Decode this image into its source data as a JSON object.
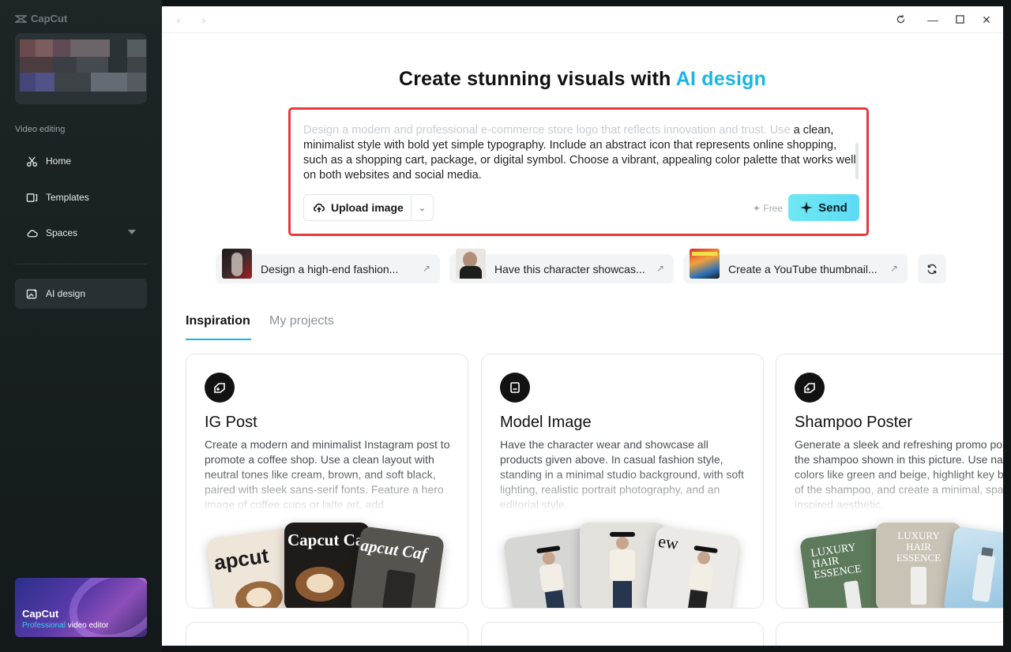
{
  "sidebar": {
    "logo_text": "CapCut",
    "section_label": "Video editing",
    "items": [
      {
        "label": "Home",
        "icon": "scissors-icon"
      },
      {
        "label": "Templates",
        "icon": "template-icon"
      },
      {
        "label": "Spaces",
        "icon": "cloud-icon"
      },
      {
        "label": "AI design",
        "icon": "ai-image-icon"
      }
    ],
    "promo": {
      "title": "CapCut",
      "sub_highlight": "Professional",
      "sub_rest": " video editor"
    }
  },
  "main": {
    "headline_prefix": "Create stunning visuals with ",
    "headline_accent": "AI design",
    "prompt": {
      "faded_line": "Design a modern and professional e-commerce store logo that reflects innovation and trust. Use",
      "text": "a clean, minimalist style with bold yet simple typography. Include an abstract icon that represents online shopping, such as a shopping cart, package, or digital symbol. Choose a vibrant, appealing color palette that works well on both websites and social media.",
      "upload_label": "Upload image",
      "free_label": "✦ Free",
      "send_label": "Send"
    },
    "suggestions": [
      {
        "label": "Design a high-end fashion..."
      },
      {
        "label": "Have this character showcas..."
      },
      {
        "label": "Create a YouTube thumbnail..."
      }
    ],
    "tabs": [
      {
        "label": "Inspiration",
        "active": true
      },
      {
        "label": "My projects",
        "active": false
      }
    ],
    "cards": [
      {
        "title": "IG Post",
        "desc": "Create a modern and minimalist Instagram post to promote a coffee shop. Use a clean layout with neutral tones like cream, brown, and soft black, paired with sleek sans-serif fonts. Feature a hero image of coffee cups or latte art, add",
        "img_text": "capcut Cafe"
      },
      {
        "title": "Model Image",
        "desc": "Have the character wear and showcase all products given above. In casual fashion style, standing in a minimal studio background, with soft lighting, realistic portrait photography, and an editorial style.",
        "img_text": "New Collection"
      },
      {
        "title": "Shampoo Poster",
        "desc": "Generate a sleek and refreshing promo poster for the shampoo shown in this picture. Use natural colors like green and beige, highlight key benefits of the shampoo, and create a minimal, spa-inspired aesthetic.",
        "img_text": "LUXURY HAIR ESSENCE"
      }
    ]
  },
  "colors": {
    "accent": "#17b6e6",
    "highlight_border": "#e5393b",
    "send_gradient": "#6fe8f2"
  }
}
